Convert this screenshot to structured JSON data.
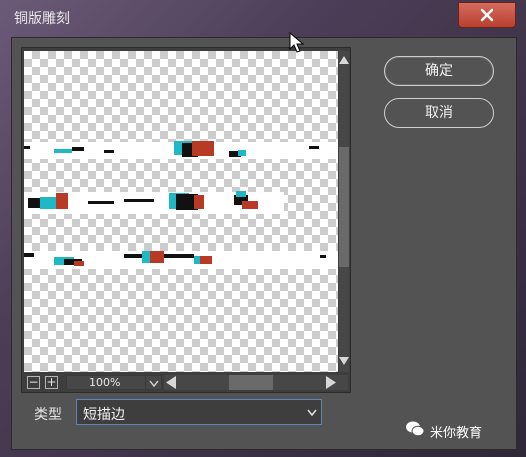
{
  "window": {
    "title": "铜版雕刻",
    "close_label": "✕"
  },
  "buttons": {
    "ok": "确定",
    "cancel": "取消"
  },
  "preview": {
    "zoom_out": "−",
    "zoom_in": "+",
    "zoom_value": "100%"
  },
  "type_field": {
    "label": "类型",
    "value": "短描边"
  },
  "watermark": {
    "text": "米你教育"
  },
  "colors": {
    "dialog_bg": "#535353",
    "accent_border": "#5d86b6"
  }
}
